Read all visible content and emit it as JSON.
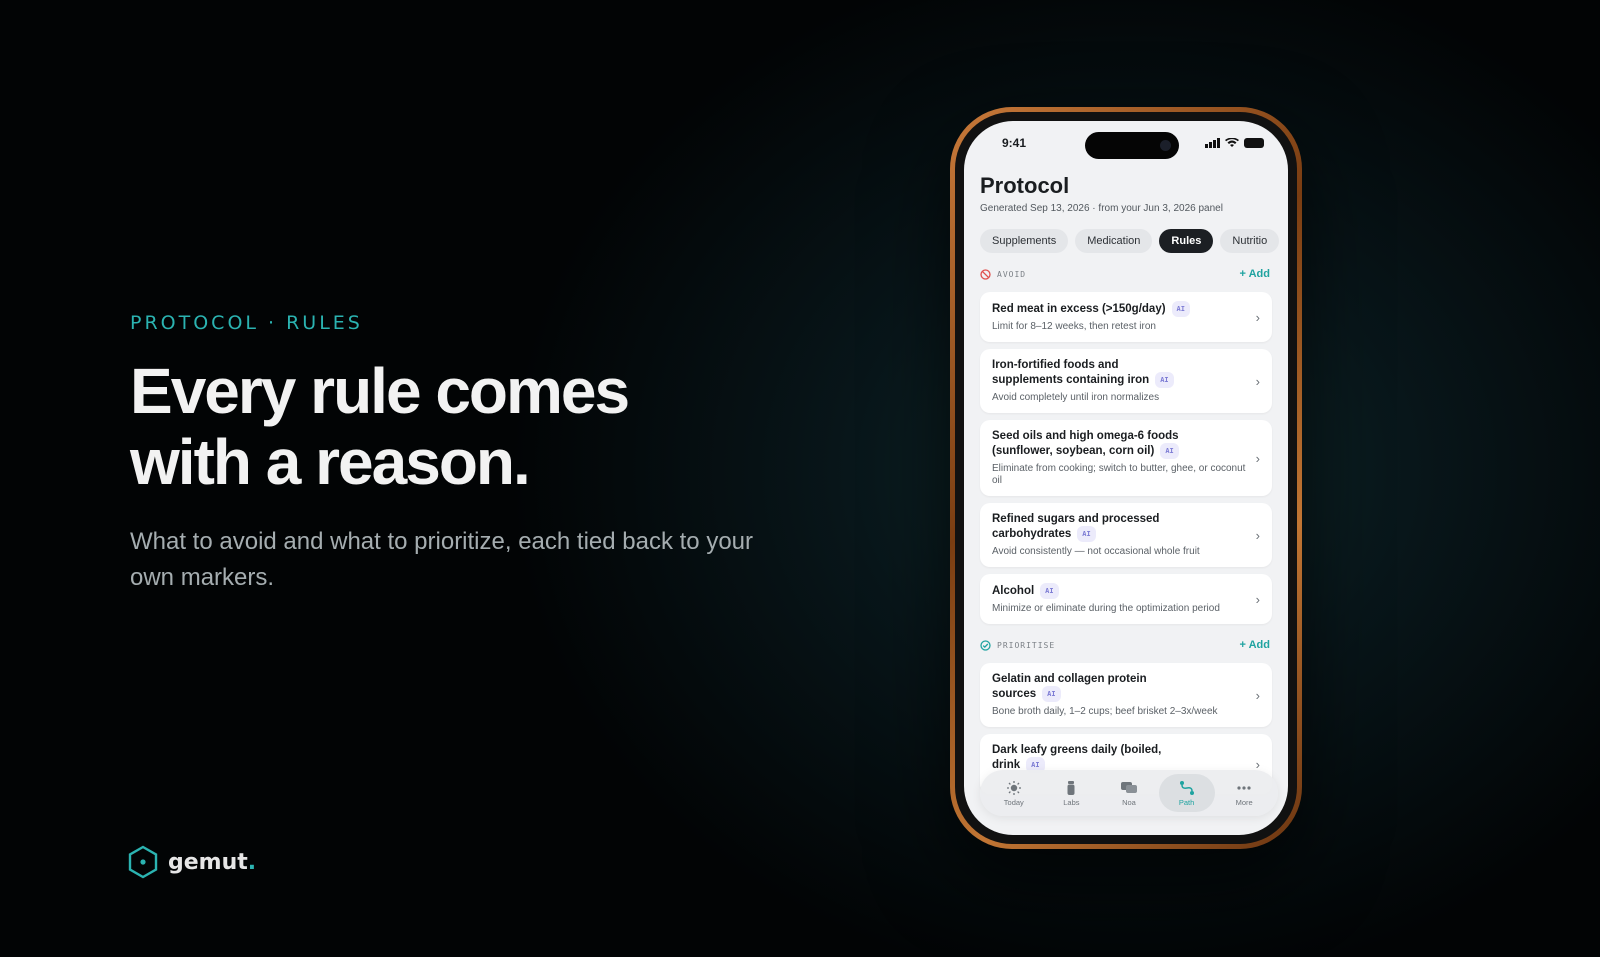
{
  "hero": {
    "eyebrow": "PROTOCOL · RULES",
    "headline_line1": "Every rule comes",
    "headline_line2": "with a reason.",
    "subtitle": "What to avoid and what to prioritize, each tied back to your own markers."
  },
  "brand": {
    "name": "gemut",
    "dot": ".",
    "accent_color": "#2bb3b1"
  },
  "phone": {
    "status_time": "9:41",
    "title": "Protocol",
    "generated": "Generated Sep 13, 2026 · from your Jun 3, 2026 panel",
    "tabs": [
      {
        "label": "Supplements",
        "active": false
      },
      {
        "label": "Medication",
        "active": false
      },
      {
        "label": "Rules",
        "active": true
      },
      {
        "label": "Nutritio",
        "active": false
      }
    ],
    "avoid": {
      "label": "AVOID",
      "add_label": "Add",
      "items": [
        {
          "title": "Red meat in excess (>150g/day)",
          "badge": "AI",
          "desc": "Limit for 8–12 weeks, then retest iron"
        },
        {
          "title": "Iron-fortified foods and supplements containing iron",
          "badge": "AI",
          "desc": "Avoid completely until iron normalizes"
        },
        {
          "title": "Seed oils and high omega-6 foods (sunflower, soybean, corn oil)",
          "badge": "AI",
          "desc": "Eliminate from cooking; switch to butter, ghee, or coconut oil"
        },
        {
          "title": "Refined sugars and processed carbohydrates",
          "badge": "AI",
          "desc": "Avoid consistently — not occasional whole fruit"
        },
        {
          "title": "Alcohol",
          "badge": "AI",
          "desc": "Minimize or eliminate during the optimization period"
        }
      ]
    },
    "prioritise": {
      "label": "PRIORITISE",
      "add_label": "Add",
      "items": [
        {
          "title": "Gelatin and collagen protein sources",
          "badge": "AI",
          "desc": "Bone broth daily, 1–2 cups; beef brisket 2–3x/week"
        },
        {
          "title": "Dark leafy greens daily (boiled, drink",
          "badge": "AI",
          "desc": ""
        }
      ]
    },
    "tabbar": [
      {
        "label": "Today",
        "icon": "sun-icon",
        "active": false
      },
      {
        "label": "Labs",
        "icon": "vial-icon",
        "active": false
      },
      {
        "label": "Noa",
        "icon": "chat-icon",
        "active": false
      },
      {
        "label": "Path",
        "icon": "path-icon",
        "active": true
      },
      {
        "label": "More",
        "icon": "more-icon",
        "active": false
      }
    ]
  }
}
